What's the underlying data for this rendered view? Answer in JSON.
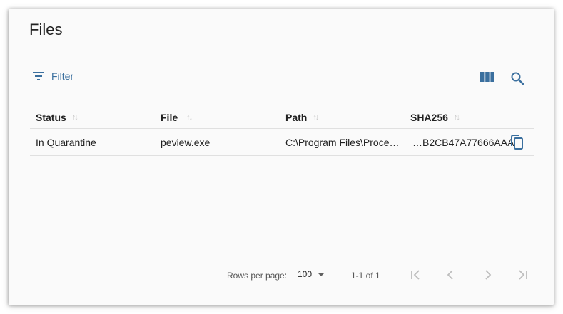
{
  "card": {
    "title": "Files"
  },
  "toolbar": {
    "filter_label": "Filter",
    "icons": {
      "filter": "filter-list-icon",
      "columns": "view-columns-icon",
      "search": "search-icon"
    }
  },
  "table": {
    "columns": [
      {
        "label": "Status"
      },
      {
        "label": "File"
      },
      {
        "label": "Path"
      },
      {
        "label": "SHA256"
      }
    ],
    "rows": [
      {
        "status": "In Quarantine",
        "file": "peview.exe",
        "path": "C:\\Program Files\\Proce…",
        "sha256": "…B2CB47A77666AAA"
      }
    ]
  },
  "pagination": {
    "rows_per_page_label": "Rows per page:",
    "rows_per_page_value": "100",
    "range_label": "1-1 of 1"
  },
  "colors": {
    "accent": "#3a6f9e",
    "disabled": "#bdbdbd"
  }
}
